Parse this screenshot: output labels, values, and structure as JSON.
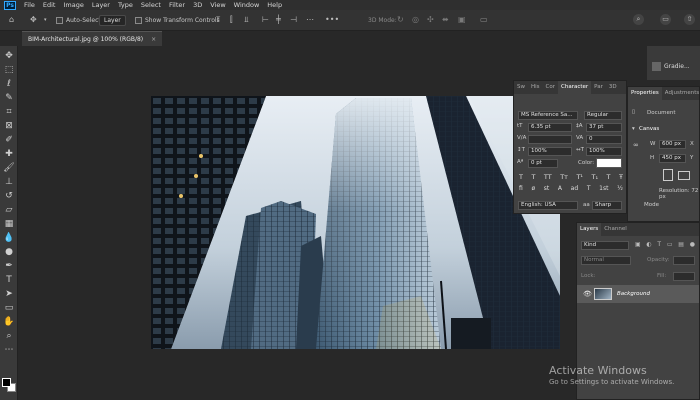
{
  "menu": {
    "logo": "Ps",
    "items": [
      "File",
      "Edit",
      "Image",
      "Layer",
      "Type",
      "Select",
      "Filter",
      "3D",
      "View",
      "Window",
      "Help"
    ]
  },
  "options": {
    "auto_select_label": "Auto-Select",
    "auto_select_target": "Layer",
    "transform_controls_label": "Show Transform Controls",
    "mode_3d_label": "3D Mode:"
  },
  "document_tab": {
    "title": "BIM-Architectural.jpg @ 100% (RGB/8)",
    "close": "×"
  },
  "mini_panel": {
    "label": "Gradie..."
  },
  "character": {
    "tabs": [
      "Sw",
      "His",
      "Cor",
      "Character",
      "Par",
      "3D"
    ],
    "active_tab": "Character",
    "font_family": "MS Reference Sa...",
    "font_style": "Regular",
    "font_size": "6.35 pt",
    "leading": "37 pt",
    "kerning": "V/A",
    "tracking": "0",
    "vertical_scale": "100%",
    "horizontal_scale": "100%",
    "baseline": "0 pt",
    "color_label": "Color:",
    "style_buttons": [
      "T",
      "T",
      "TT",
      "Tт",
      "T¹",
      "T₁",
      "T",
      "Ŧ"
    ],
    "opentype_buttons": [
      "fi",
      "ø",
      "st",
      "A",
      "ad",
      "T",
      "1st",
      "½"
    ],
    "language": "English: USA",
    "antialias_label": "aa",
    "antialias": "Sharp"
  },
  "properties": {
    "tabs": [
      "Properties",
      "Adjustments"
    ],
    "active_tab": "Properties",
    "doc_label": "Document",
    "canvas_section": "Canvas",
    "width_label": "W",
    "width": "600 px",
    "height_label": "H",
    "height": "450 px",
    "x_label": "X",
    "y_label": "Y",
    "resolution": "Resolution: 72 px",
    "mode_label": "Mode"
  },
  "layers": {
    "tabs": [
      "Layers",
      "Channel"
    ],
    "active_tab": "Layers",
    "search_placeholder": "Kind",
    "blend_mode": "Normal",
    "opacity_label": "Opacity:",
    "lock_label": "Lock:",
    "fill_label": "Fill:",
    "items": [
      {
        "name": "Background",
        "visible": true
      }
    ]
  },
  "watermark": {
    "title": "Activate Windows",
    "subtitle": "Go to Settings to activate Windows."
  }
}
